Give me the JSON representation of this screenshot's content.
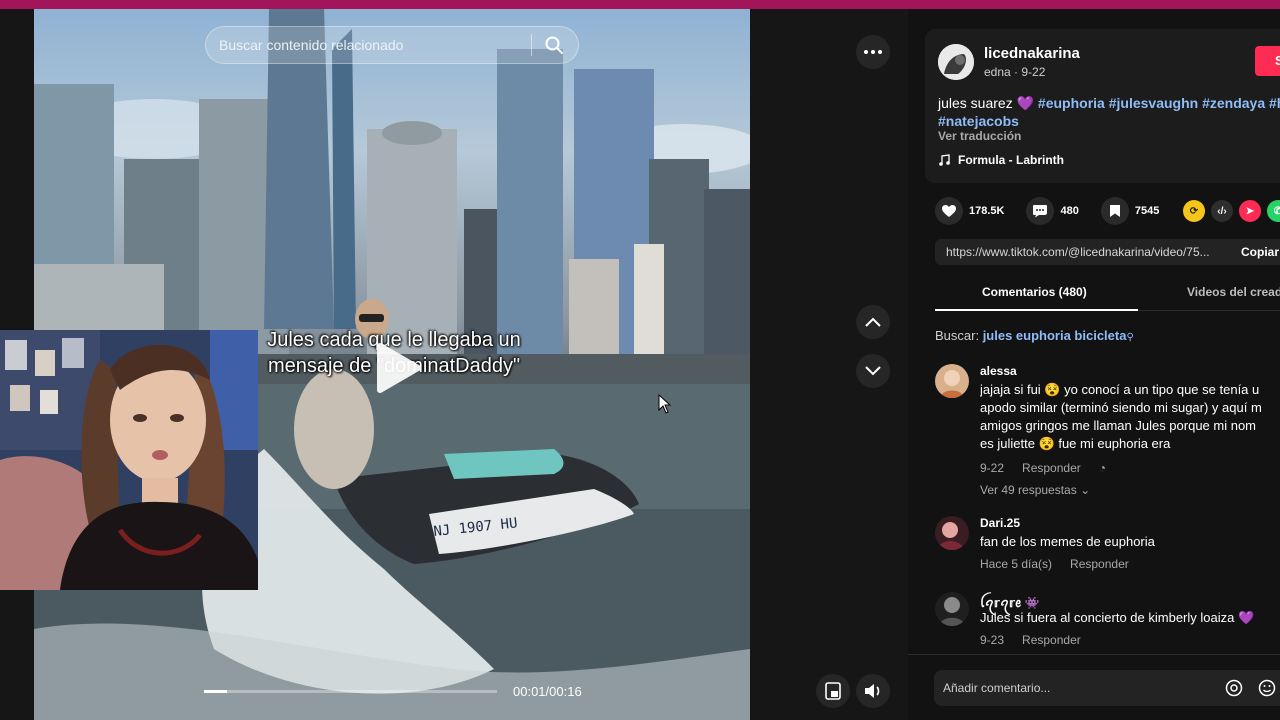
{
  "video": {
    "search_placeholder": "Buscar contenido relacionado",
    "caption": "Jules cada que le llegaba un mensaje de \"dominatDaddy\"",
    "time": "00:01/00:16",
    "progress": 0.08,
    "boat_registration": "NJ 1907 HU"
  },
  "post": {
    "username": "licednakarina",
    "subtitle": "edna · 9-22",
    "follow_label": "S",
    "desc_text": "jules suarez 💜 ",
    "hashtags": [
      "#euphoria",
      "#julesvaughn",
      "#zendaya",
      "#h"
    ],
    "hashtag_line2": "#natejacobs",
    "see_translation": "Ver traducción",
    "music": "Formula - Labrinth",
    "likes": "178.5K",
    "comments_count": "480",
    "saves": "7545",
    "url": "https://www.tiktok.com/@licednakarina/video/75...",
    "copy_label": "Copiar"
  },
  "tabs": {
    "comments": "Comentarios (480)",
    "creator_videos": "Videos del cread"
  },
  "search": {
    "prefix": "Buscar: ",
    "query": "jules euphoria bicicleta"
  },
  "comments": [
    {
      "user": "alessa",
      "lines": [
        "jajaja si fui 😵 yo conocí a un tipo que se tenía u",
        "apodo similar (terminó siendo mi sugar) y aquí m",
        "amigos gringos me llaman Jules porque mi nom",
        "es juliette 😵 fue mi euphoria era"
      ],
      "date": "9-22",
      "reply": "Responder",
      "more": "Ver 49 respuestas"
    },
    {
      "user": "Dari.25",
      "lines": [
        "fan de los memes de euphoria"
      ],
      "date": "Hace 5 día(s)",
      "reply": "Responder"
    },
    {
      "user": "ꪶꪖ𝕣ꪖ𝕣ꫀ 👾",
      "lines": [
        "Jules si fuera al concierto de kimberly loaiza 💜"
      ],
      "date": "9-23",
      "reply": "Responder"
    }
  ],
  "add_comment_placeholder": "Añadir comentario...",
  "colors": {
    "accent": "#fe2c55",
    "hashtag": "#8fbdf7",
    "topbar": "#a3155b"
  }
}
